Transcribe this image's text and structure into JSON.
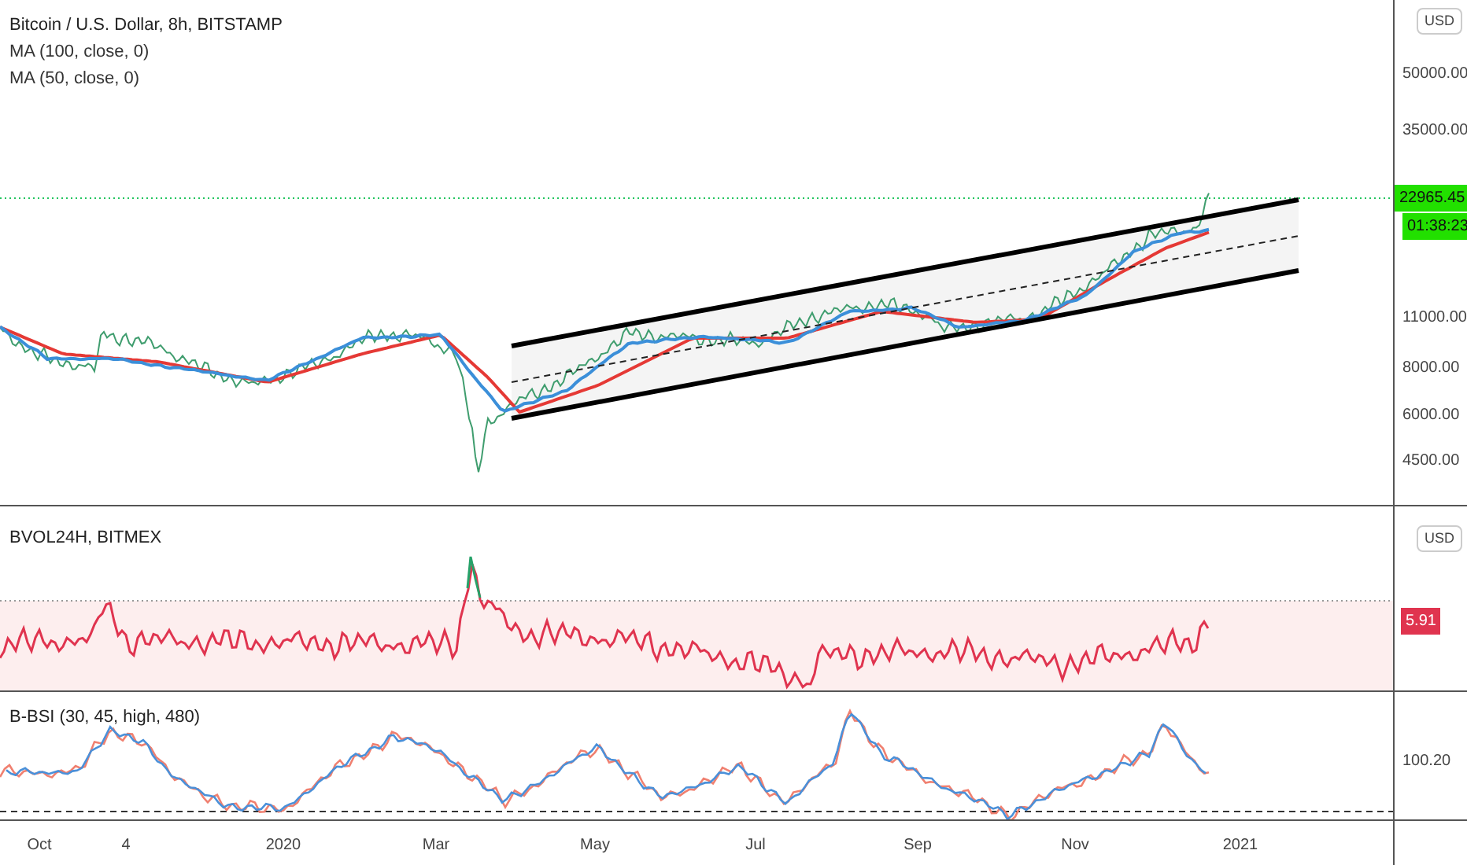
{
  "legend": {
    "title": "Bitcoin / U.S. Dollar, 8h, BITSTAMP",
    "studies": [
      "MA (100, close, 0)",
      "MA (50, close, 0)"
    ]
  },
  "main_axis": {
    "currency": "USD",
    "labels": [
      "50000.00",
      "35000.00",
      "11000.00",
      "8000.00",
      "6000.00",
      "4500.00"
    ],
    "last_price": "22965.45",
    "countdown": "01:38:23"
  },
  "volatility_pane": {
    "title": "BVOL24H, BITMEX",
    "currency": "USD",
    "last_value": "5.91"
  },
  "bsi_pane": {
    "title": "B-BSI (30, 45, high, 480)",
    "labels": [
      "100.20"
    ]
  },
  "time_axis": [
    "Oct",
    "4",
    "2020",
    "Mar",
    "May",
    "Jul",
    "Sep",
    "Nov",
    "2021"
  ]
}
